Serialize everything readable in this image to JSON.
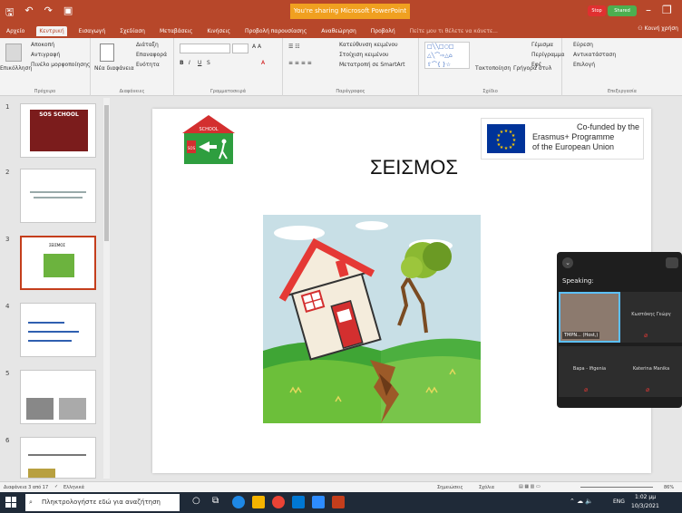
{
  "titlebar": {
    "banner": "You're sharing Microsoft PowerPoint",
    "stop": "Stop",
    "shared": "Shared"
  },
  "tabs": [
    "Αρχείο",
    "Κεντρική",
    "Εισαγωγή",
    "Σχεδίαση",
    "Μεταβάσεις",
    "Κινήσεις",
    "Προβολή παρουσίασης",
    "Αναθεώρηση",
    "Προβολή",
    "Πείτε μου τι θέλετε να κάνετε..."
  ],
  "share_label": "Κοινή χρήση",
  "ribbon": {
    "clipboard": {
      "paste": "Επικόλληση",
      "cut": "Αποκοπή",
      "copy": "Αντιγραφή",
      "format": "Πινέλο μορφοποίησης",
      "label": "Πρόχειρο"
    },
    "slides": {
      "new": "Νέα διαφάνεια",
      "layout": "Διάταξη",
      "reset": "Επαναφορά",
      "section": "Ενότητα",
      "label": "Διαφάνειες"
    },
    "font": {
      "label": "Γραμματοσειρά"
    },
    "paragraph": {
      "direction": "Κατεύθυνση κειμένου",
      "align": "Στοίχιση κειμένου",
      "smartart": "Μετατροπή σε SmartArt",
      "label": "Παράγραφος"
    },
    "drawing": {
      "arrange": "Τακτοποίηση",
      "styles": "Γρήγορα στυλ",
      "fill": "Γέμισμα",
      "outline": "Περίγραμμα",
      "effects": "Εφέ",
      "label": "Σχέδιο"
    },
    "editing": {
      "find": "Εύρεση",
      "replace": "Αντικατάσταση",
      "select": "Επιλογή",
      "label": "Επεξεργασία"
    }
  },
  "slides": [
    {
      "num": "1",
      "title": "SOS SCHOOL"
    },
    {
      "num": "2"
    },
    {
      "num": "3",
      "title": "ΣΕΙΣΜΟΣ"
    },
    {
      "num": "4"
    },
    {
      "num": "5"
    },
    {
      "num": "6"
    }
  ],
  "slide": {
    "title": "ΣΕΙΣΜΟΣ",
    "school_sign": "SCHOOL",
    "sos": "SOS",
    "cofunded": "Co-funded by the",
    "programme": "Erasmus+ Programme",
    "eu": "of the European Union"
  },
  "zoom": {
    "speaking": "Speaking:",
    "p1": "TMPN... (Host,)",
    "p2": "Κωστάκης Γεώργ",
    "p3": "Bapa - Ifigenia",
    "p4": "Katerina Manika"
  },
  "status": {
    "slide": "Διαφάνεια 3 από 17",
    "lang": "Ελληνικά",
    "notes": "Σημειώσεις",
    "comments": "Σχόλια",
    "zoom": "86%"
  },
  "taskbar": {
    "search": "Πληκτρολογήστε εδώ για αναζήτηση",
    "lang": "ENG",
    "time": "1:02 μμ",
    "date": "10/3/2021"
  }
}
